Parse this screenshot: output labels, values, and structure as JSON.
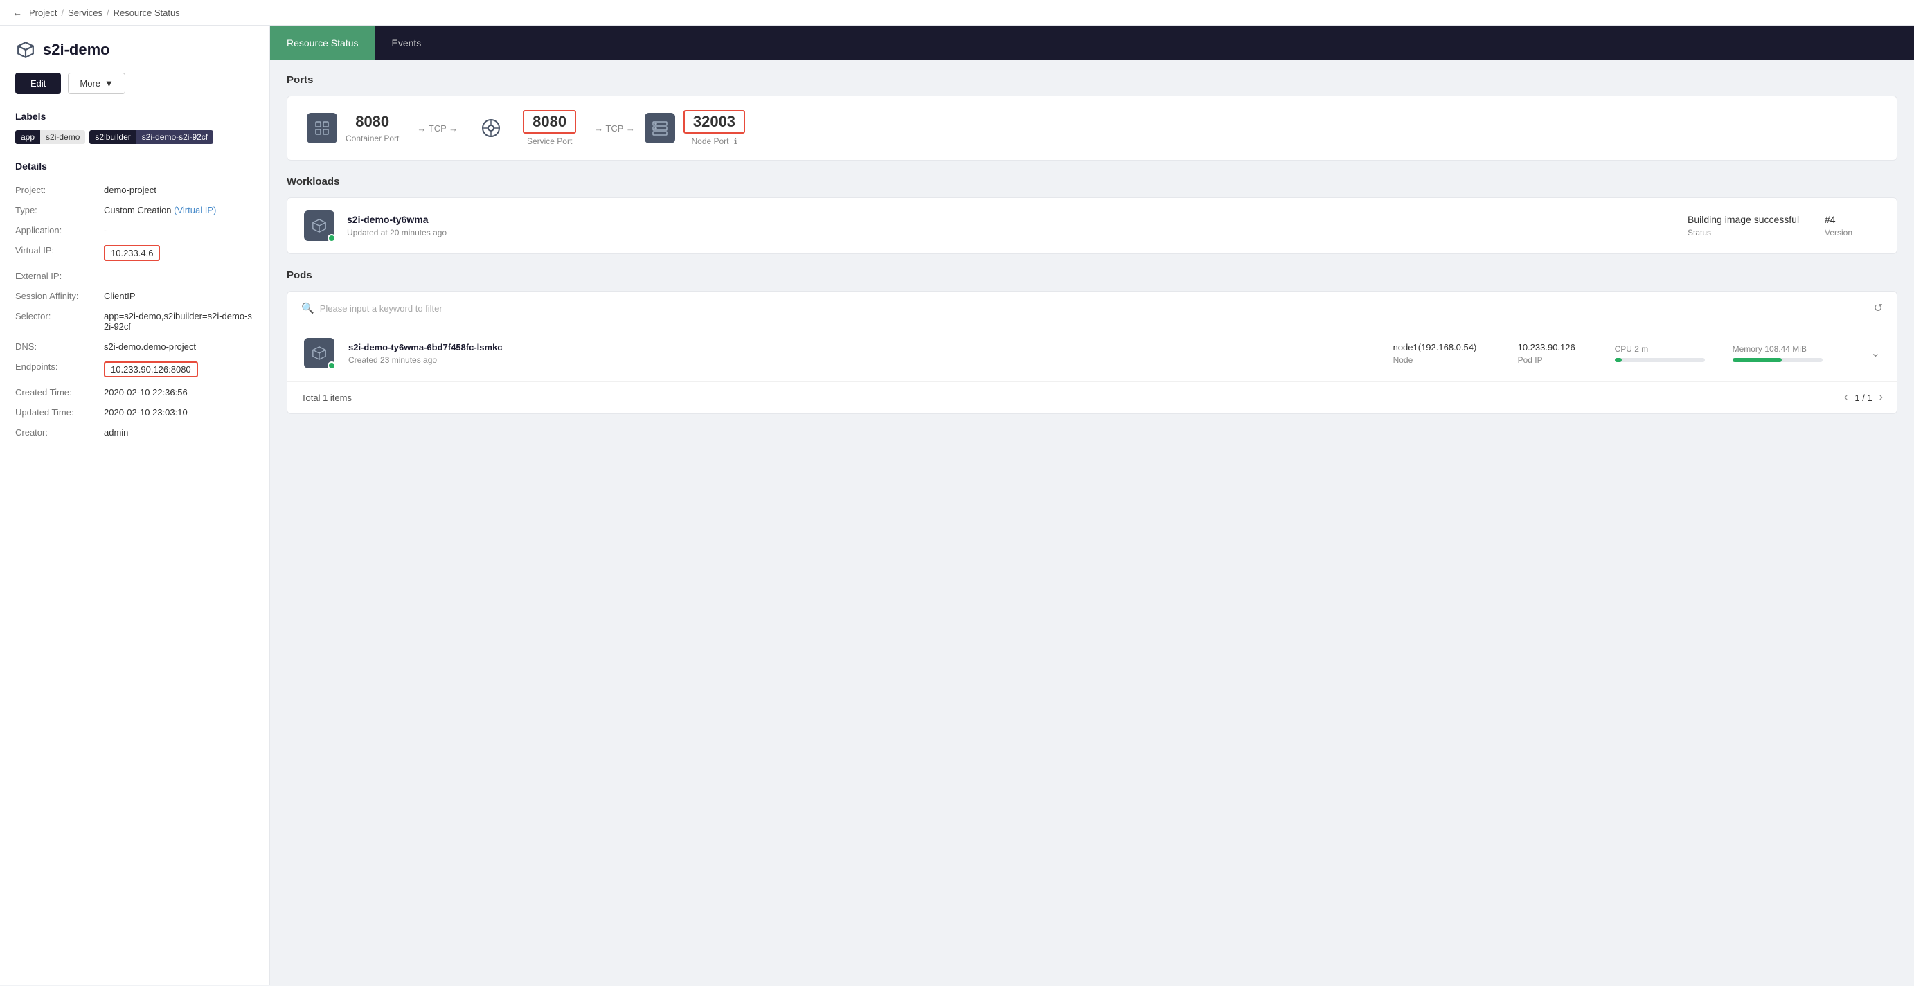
{
  "breadcrumb": {
    "back": "←",
    "project": "Project",
    "sep1": "/",
    "services": "Services",
    "sep2": "/",
    "current": "Resource Status"
  },
  "sidebar": {
    "app_name": "s2i-demo",
    "edit_btn": "Edit",
    "more_btn": "More",
    "labels_title": "Labels",
    "labels": [
      {
        "key": "app",
        "value": "s2i-demo",
        "dark": false
      },
      {
        "key": "s2ibuilder",
        "value": "s2i-demo-s2i-92cf",
        "dark": true
      }
    ],
    "details_title": "Details",
    "details": [
      {
        "label": "Project:",
        "value": "demo-project",
        "highlighted": false
      },
      {
        "label": "Type:",
        "value": "Custom Creation (Virtual IP)",
        "highlighted": false
      },
      {
        "label": "Application:",
        "value": "-",
        "highlighted": false
      },
      {
        "label": "Virtual IP:",
        "value": "10.233.4.6",
        "highlighted": true
      },
      {
        "label": "External IP:",
        "value": "",
        "highlighted": false
      },
      {
        "label": "Session Affinity:",
        "value": "ClientIP",
        "highlighted": false
      },
      {
        "label": "Selector:",
        "value": "app=s2i-demo,s2ibuilder=s2i-demo-s2i-92cf",
        "highlighted": false
      },
      {
        "label": "DNS:",
        "value": "s2i-demo.demo-project",
        "highlighted": false
      },
      {
        "label": "Endpoints:",
        "value": "10.233.90.126:8080",
        "highlighted": true
      },
      {
        "label": "Created Time:",
        "value": "2020-02-10 22:36:56",
        "highlighted": false
      },
      {
        "label": "Updated Time:",
        "value": "2020-02-10 23:03:10",
        "highlighted": false
      },
      {
        "label": "Creator:",
        "value": "admin",
        "highlighted": false
      }
    ]
  },
  "tabs": [
    {
      "label": "Resource Status",
      "active": true
    },
    {
      "label": "Events",
      "active": false
    }
  ],
  "ports_section": {
    "title": "Ports",
    "container_port": "8080",
    "container_port_label": "Container Port",
    "arrow1": "→ TCP →",
    "service_port": "8080",
    "service_port_label": "Service Port",
    "arrow2": "→ TCP →",
    "node_port": "32003",
    "node_port_label": "Node Port"
  },
  "workloads_section": {
    "title": "Workloads",
    "items": [
      {
        "name": "s2i-demo-ty6wma",
        "time": "Updated at 20 minutes ago",
        "status": "Building image successful",
        "status_label": "Status",
        "version": "#4",
        "version_label": "Version"
      }
    ]
  },
  "pods_section": {
    "title": "Pods",
    "filter_placeholder": "Please input a keyword to filter",
    "total_label": "Total 1 items",
    "pagination": "1 / 1",
    "items": [
      {
        "name": "s2i-demo-ty6wma-6bd7f458fc-lsmkc",
        "time": "Created 23 minutes ago",
        "node": "node1(192.168.0.54)",
        "node_label": "Node",
        "pod_ip": "10.233.90.126",
        "pod_ip_label": "Pod IP",
        "cpu": "CPU 2 m",
        "cpu_pct": 8,
        "memory": "Memory 108.44 MiB",
        "memory_pct": 55
      }
    ]
  }
}
